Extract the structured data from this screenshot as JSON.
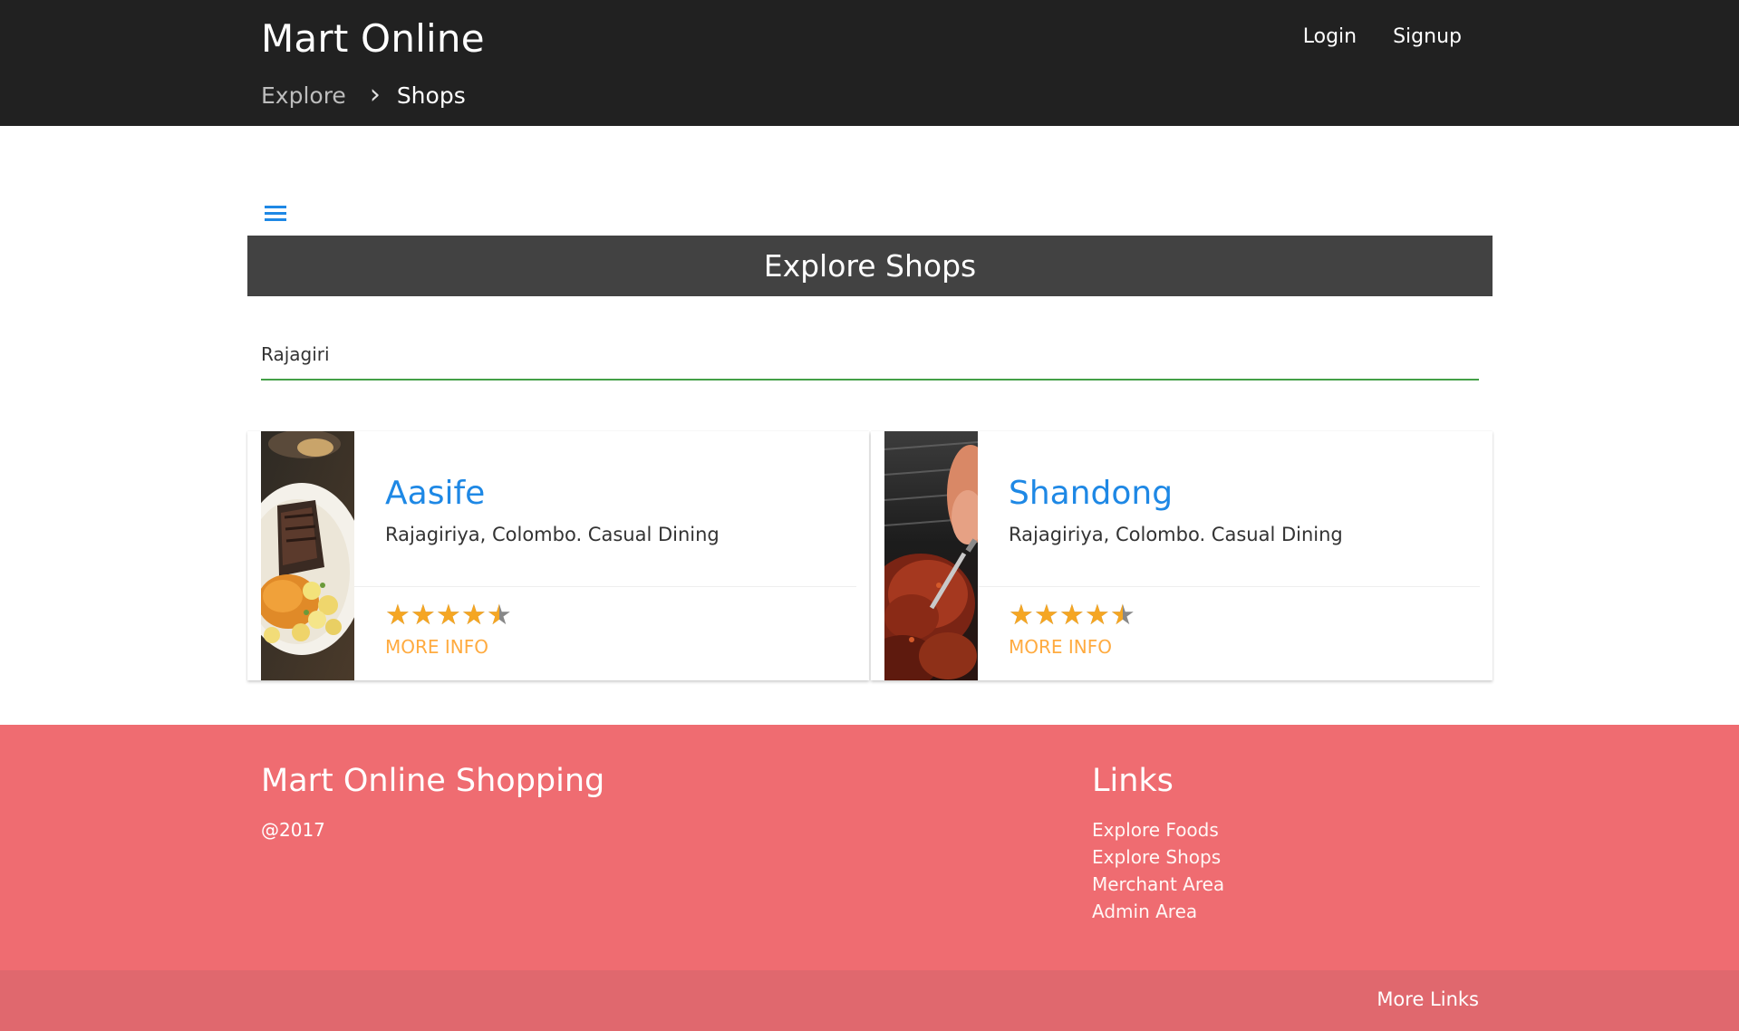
{
  "header": {
    "brand": "Mart Online",
    "nav": {
      "login": "Login",
      "signup": "Signup"
    },
    "breadcrumb": {
      "previous": "Explore",
      "separator": "›",
      "current": "Shops"
    }
  },
  "menu": {
    "icon": "hamburger-menu-icon"
  },
  "section": {
    "title": "Explore Shops"
  },
  "search": {
    "value": "Rajagiri",
    "placeholder": ""
  },
  "shops": [
    {
      "name": "Aasife",
      "description": "Rajagiriya, Colombo. Casual Dining",
      "rating": 4.5,
      "rating_max": 5,
      "more_info": "MORE INFO",
      "image": "food-plate-photo"
    },
    {
      "name": "Shandong",
      "description": "Rajagiriya, Colombo. Casual Dining",
      "rating": 4.5,
      "rating_max": 5,
      "more_info": "MORE INFO",
      "image": "grilled-meat-photo"
    }
  ],
  "footer": {
    "title": "Mart Online Shopping",
    "copyright": "@2017",
    "links_title": "Links",
    "links": [
      "Explore Foods",
      "Explore Shops",
      "Merchant Area",
      "Admin Area"
    ],
    "more_links": "More Links"
  },
  "colors": {
    "header_bg": "#212121",
    "banner_bg": "#424242",
    "accent_blue": "#1e88e5",
    "search_underline": "#43a047",
    "star": "#f5a623",
    "more_info": "#ffab40",
    "footer_bg": "#ef6c71",
    "footer_bottom_bg": "#e0686e"
  }
}
